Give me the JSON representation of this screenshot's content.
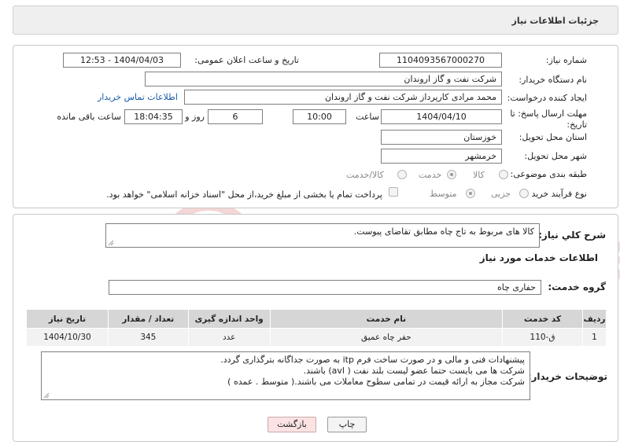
{
  "header": {
    "title": "جزئیات اطلاعات نیاز"
  },
  "form": {
    "need_number": {
      "label": "شماره نیاز:",
      "value": "1104093567000270"
    },
    "announce_datetime": {
      "label": "تاریخ و ساعت اعلان عمومی:",
      "value": "1404/04/03 - 12:53"
    },
    "buyer_org": {
      "label": "نام دستگاه خریدار:",
      "value": "شرکت نفت و گاز اروندان"
    },
    "requester": {
      "label": "ایجاد کننده درخواست:",
      "value": "محمد مرادی کارپرداز شرکت نفت و گاز اروندان"
    },
    "buyer_contact_link": "اطلاعات تماس خریدار",
    "deadline": {
      "label": "مهلت ارسال پاسخ: تا تاریخ:",
      "date": "1404/04/10",
      "time_label": "ساعت",
      "time": "10:00",
      "days": "6",
      "days_label": "روز و",
      "remaining": "18:04:35",
      "remaining_label": "ساعت باقی مانده"
    },
    "province": {
      "label": "استان محل تحویل:",
      "value": "خوزستان"
    },
    "city": {
      "label": "شهر محل تحویل:",
      "value": "خرمشهر"
    },
    "category": {
      "label": "طبقه بندی موضوعی:",
      "options": [
        "کالا",
        "خدمت",
        "کالا/خدمت"
      ],
      "selected": "خدمت"
    },
    "purchase_type": {
      "label": "نوع فرآیند خرید :",
      "options": [
        "جزیی",
        "متوسط"
      ],
      "selected": "متوسط",
      "payment_note": "پرداخت تمام یا بخشی از مبلغ خرید،از محل \"اسناد خزانه اسلامی\" خواهد بود."
    }
  },
  "summary": {
    "label": "شرح کلي نياز:",
    "value": "کالا های مربوط به تاج چاه مطابق تقاضای پیوست."
  },
  "services": {
    "section_title": "اطلاعات خدمات مورد نیاز",
    "group_label": "گروه خدمت:",
    "group_value": "حفاری چاه",
    "columns": [
      "ردیف",
      "کد خدمت",
      "نام خدمت",
      "واحد اندازه گیری",
      "تعداد / مقدار",
      "تاریخ نیاز"
    ],
    "rows": [
      [
        "1",
        "ق-110",
        "حفر چاه عمیق",
        "عدد",
        "345",
        "1404/10/30"
      ]
    ]
  },
  "buyer_notes": {
    "label": "توضیحات خریدار:",
    "lines": [
      "پیشنهادات فنی و مالی و در صورت ساخت  فرم itp به صورت جداگانه بترگذاری گردد.",
      "شرکت ها می بایست حتما عضو لیست بلند نفت ( avl) باشند.",
      "شرکت مجاز به ارائه قیمت در تمامی سطوح معاملات می باشند.( متوسط . عمده )"
    ]
  },
  "buttons": {
    "print": "چاپ",
    "back": "بازگشت"
  },
  "colors": {
    "link": "#1a5aa8",
    "back_button_bg": "#fbe3e3",
    "header_bg": "#efefef"
  }
}
